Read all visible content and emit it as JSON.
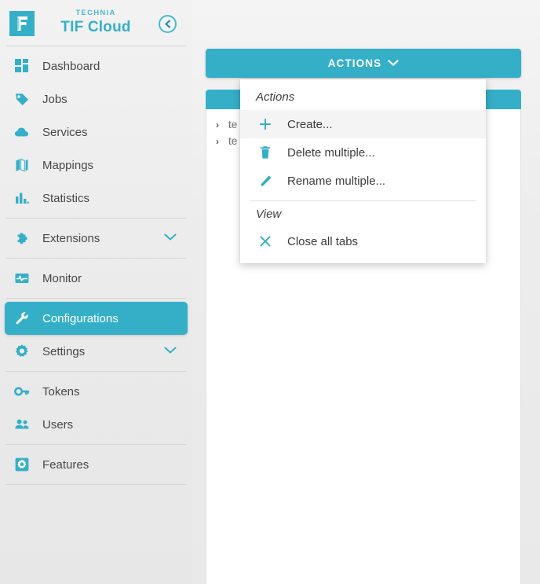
{
  "brand": {
    "logo_icon": "technia-f-logo-icon",
    "subtitle": "TECHNIA",
    "title": "TIF Cloud",
    "collapse_icon": "circle-arrow-left-icon"
  },
  "colors": {
    "accent": "#35afc8",
    "sidebar_bg": "#ededed",
    "text": "#474747",
    "menu_text": "#3b3b3b"
  },
  "sidebar": {
    "groups": [
      {
        "items": [
          {
            "label": "Dashboard",
            "icon": "dashboard-grid-icon",
            "selected": false,
            "expandable": false
          },
          {
            "label": "Jobs",
            "icon": "tag-icon",
            "selected": false,
            "expandable": false
          },
          {
            "label": "Services",
            "icon": "cloud-icon",
            "selected": false,
            "expandable": false
          },
          {
            "label": "Mappings",
            "icon": "map-icon",
            "selected": false,
            "expandable": false
          },
          {
            "label": "Statistics",
            "icon": "bar-chart-icon",
            "selected": false,
            "expandable": false
          }
        ]
      },
      {
        "items": [
          {
            "label": "Extensions",
            "icon": "puzzle-piece-icon",
            "selected": false,
            "expandable": true
          }
        ]
      },
      {
        "items": [
          {
            "label": "Monitor",
            "icon": "pulse-monitor-icon",
            "selected": false,
            "expandable": false
          }
        ]
      },
      {
        "items": [
          {
            "label": "Configurations",
            "icon": "wrench-icon",
            "selected": true,
            "expandable": false
          },
          {
            "label": "Settings",
            "icon": "gear-icon",
            "selected": false,
            "expandable": true
          }
        ]
      },
      {
        "items": [
          {
            "label": "Tokens",
            "icon": "key-icon",
            "selected": false,
            "expandable": false
          },
          {
            "label": "Users",
            "icon": "users-icon",
            "selected": false,
            "expandable": false
          }
        ]
      },
      {
        "items": [
          {
            "label": "Features",
            "icon": "gear-square-icon",
            "selected": false,
            "expandable": false
          }
        ]
      }
    ]
  },
  "main": {
    "actions_button": {
      "label": "ACTIONS",
      "chevron_icon": "chevron-down-icon"
    },
    "tree_rows": [
      {
        "chevron_icon": "chevron-right-icon",
        "label": "te"
      },
      {
        "chevron_icon": "chevron-right-icon",
        "label": "te"
      }
    ]
  },
  "actions_menu": {
    "sections": [
      {
        "title": "Actions",
        "items": [
          {
            "label": "Create...",
            "icon": "plus-icon",
            "highlighted": true
          },
          {
            "label": "Delete multiple...",
            "icon": "trash-icon",
            "highlighted": false
          },
          {
            "label": "Rename multiple...",
            "icon": "pencil-icon",
            "highlighted": false
          }
        ]
      },
      {
        "title": "View",
        "items": [
          {
            "label": "Close all tabs",
            "icon": "close-x-icon",
            "highlighted": false
          }
        ]
      }
    ]
  }
}
